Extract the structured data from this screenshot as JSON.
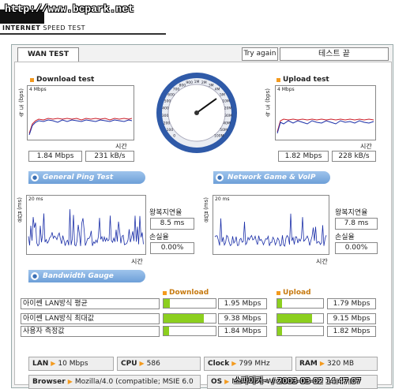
{
  "header": {
    "url": "http://www.bcpark.net",
    "title_bold": "INTERNET",
    "title_rest": " SPEED TEST"
  },
  "tabs": {
    "wan_test": "WAN TEST",
    "try_again": "Try again",
    "status": "테스트 끝"
  },
  "download": {
    "title": "Download test",
    "ylabel": "속 도 (bps)",
    "scale": "4 Mbps",
    "xlabel": "시간",
    "mbps": "1.84 Mbps",
    "kbs": "231 kB/s"
  },
  "upload": {
    "title": "Upload test",
    "ylabel": "속 도 (bps)",
    "scale": "4 Mbps",
    "xlabel": "시간",
    "mbps": "1.82 Mbps",
    "kbs": "228 kB/s"
  },
  "gauge": {
    "ticks": [
      "0",
      "100",
      "200",
      "300",
      "400",
      "500",
      "600",
      "700",
      "800",
      "900",
      "1M",
      "2M",
      "3M",
      "4M",
      "5M",
      "10M",
      "20M",
      "30M",
      "40M",
      "50M",
      "100M"
    ],
    "needle_value": "1.84M"
  },
  "sections": {
    "ping": "General Ping Test",
    "game": "Network Game & VoIP Test",
    "bandwidth": "Bandwidth Gauge"
  },
  "ping": {
    "ylabel": "응답 (ms)",
    "scale": "20 ms",
    "xlabel": "시간",
    "rtt_label": "왕복지연율",
    "rtt": "8.5 ms",
    "loss_label": "손실율",
    "loss": "0.00%"
  },
  "game": {
    "ylabel": "응답 (ms)",
    "scale": "20 ms",
    "xlabel": "시간",
    "rtt_label": "왕복지연율",
    "rtt": "7.8 ms",
    "loss_label": "손실율",
    "loss": "0.00%"
  },
  "bandwidth": {
    "download_label": "Download",
    "upload_label": "Upload",
    "rows": [
      {
        "name": "아이쎈 LAN방식 평균",
        "down": "1.95 Mbps",
        "down_fill": 0.12,
        "up": "1.79 Mbps",
        "up_fill": 0.11
      },
      {
        "name": "아이쎈 LAN방식 최대값",
        "down": "9.38 Mbps",
        "down_fill": 0.78,
        "up": "9.15 Mbps",
        "up_fill": 0.75
      },
      {
        "name": "사용자 측정값",
        "down": "1.84 Mbps",
        "down_fill": 0.11,
        "up": "1.82 Mbps",
        "up_fill": 0.11
      }
    ]
  },
  "sysinfo": {
    "lan_label": "LAN",
    "lan": "10 Mbps",
    "cpu_label": "CPU",
    "cpu": "586",
    "clock_label": "Clock",
    "clock": "799 MHz",
    "ram_label": "RAM",
    "ram": "320 MB",
    "browser_label": "Browser",
    "browser": "Mozilla/4.0 (compatible; MSIE 6.0",
    "os_label": "OS",
    "os": "Microsoft Windows XP"
  },
  "watermark": "스파이커~ / 2003-03-02 14:47:07",
  "colors": {
    "accent": "#f39a1e",
    "section_bar": "#6d9fd8",
    "gauge_ring": "#2f5aa8",
    "graph_line_red": "#cc1f2a",
    "graph_line_blue": "#1b2fa8",
    "bar_fill": "#8ccf1f"
  }
}
